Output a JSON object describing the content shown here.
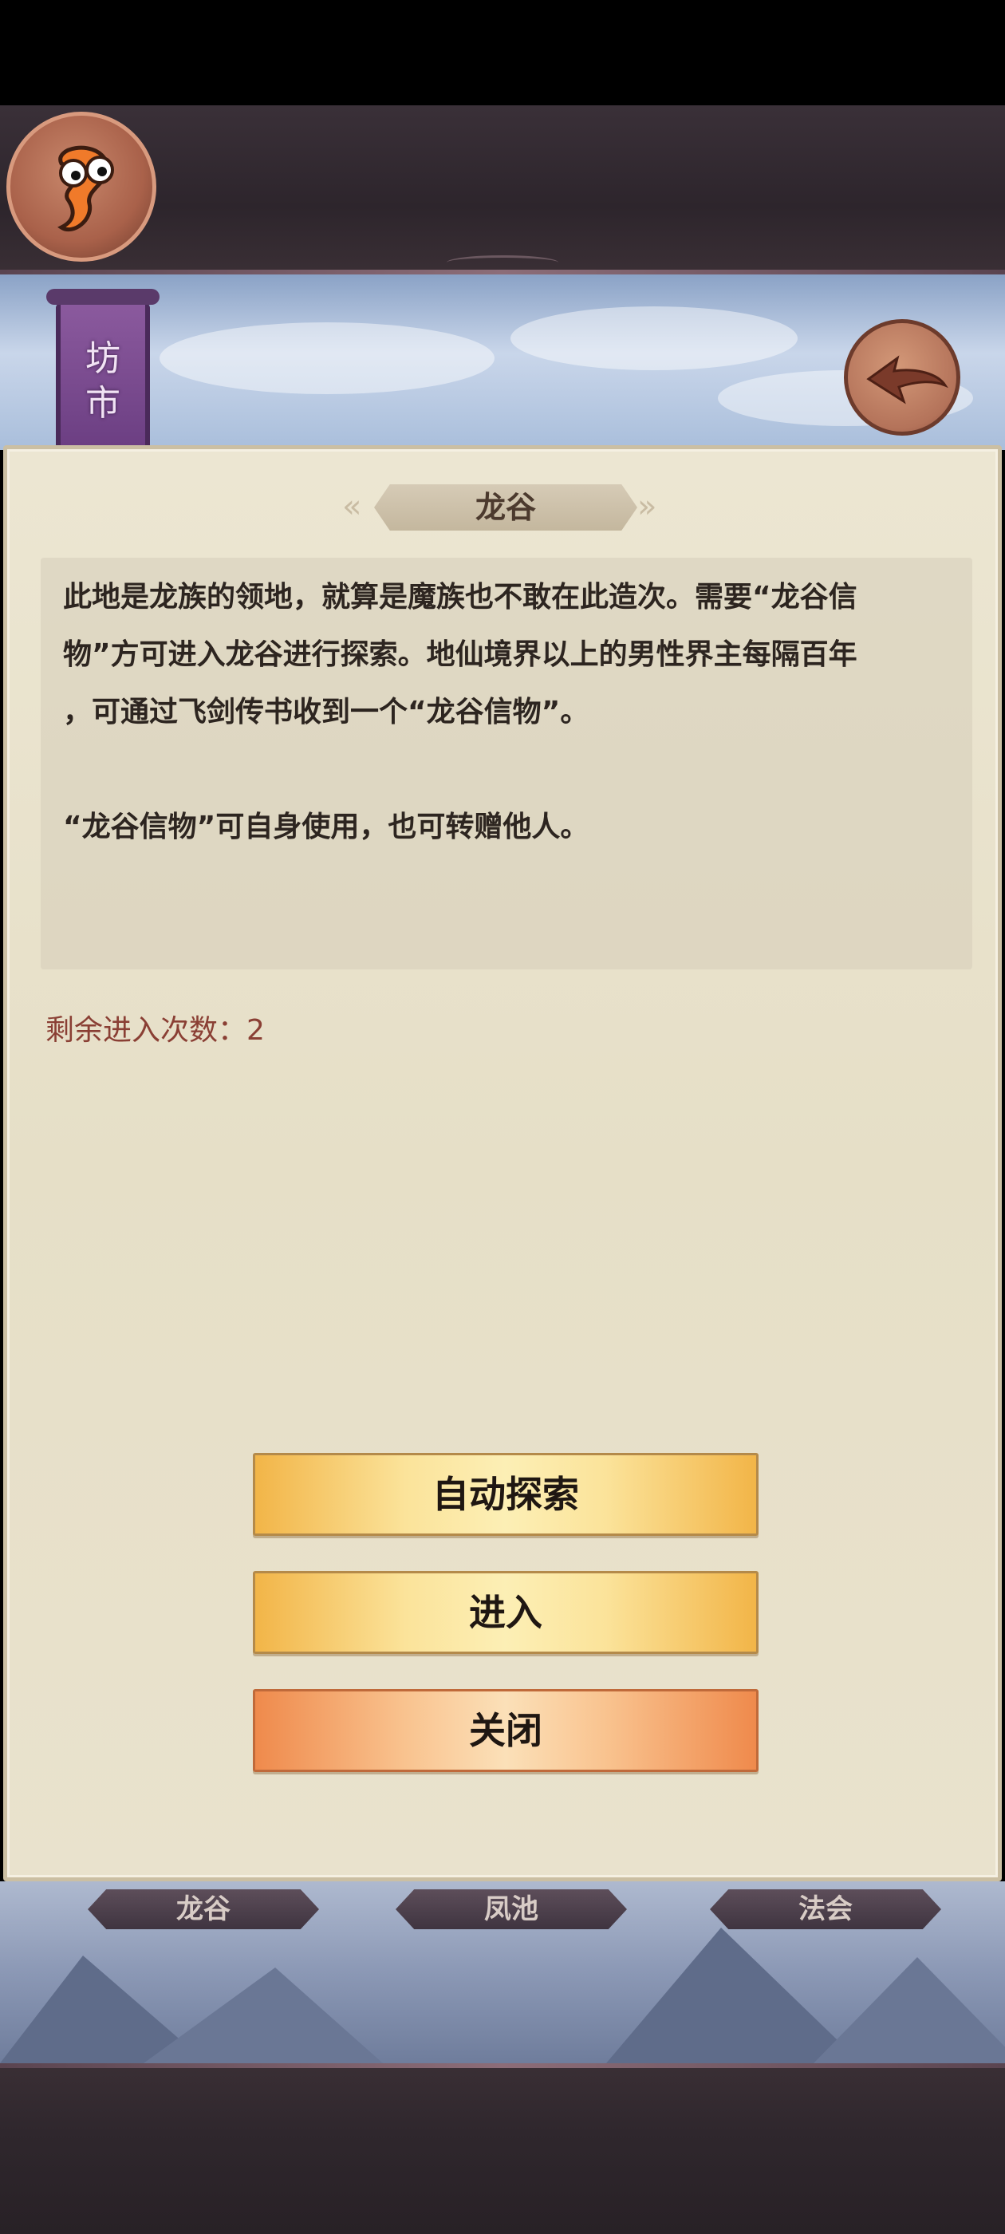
{
  "header": {
    "banner_label": "坊\n市"
  },
  "dialog": {
    "title": "龙谷",
    "description_1": "此地是龙族的领地，就算是魔族也不敢在此造次。需要“龙谷信\n物”方可进入龙谷进行探索。地仙境界以上的男性界主每隔百年\n，可通过飞剑传书收到一个“龙谷信物”。",
    "description_2": "“龙谷信物”可自身使用，也可转赠他人。",
    "remaining_entries": "剩余进入次数：2",
    "buttons": {
      "auto_explore": "自动探索",
      "enter": "进入",
      "close": "关闭"
    }
  },
  "bottom_tabs": [
    "龙谷",
    "凤池",
    "法会"
  ],
  "colors": {
    "dialog_bg": "#e6dfc7",
    "remaining_text": "#8a3f34",
    "button_yellow": "#f2b548",
    "button_orange": "#ef8a4c"
  },
  "icons": {
    "avatar": "cartoon-mascot-icon",
    "back": "back-arrow-icon"
  }
}
